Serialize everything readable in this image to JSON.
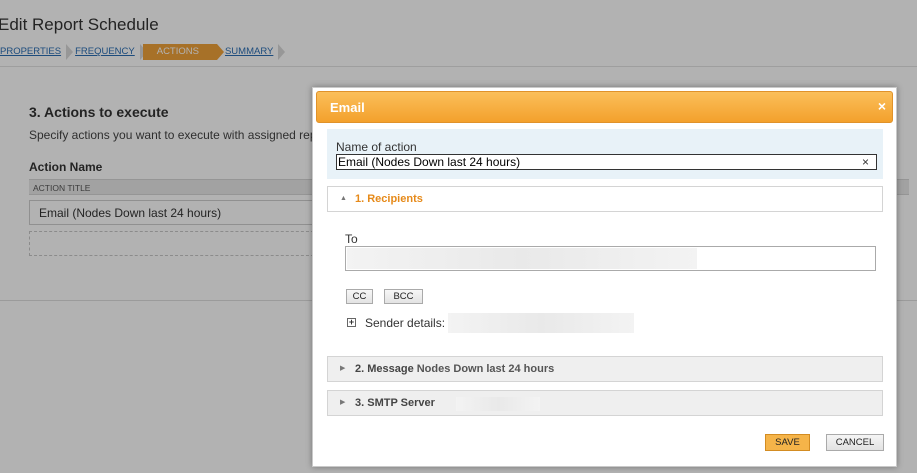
{
  "page": {
    "title": "Edit Report Schedule",
    "breadcrumbs": [
      {
        "label": "PROPERTIES",
        "active": false
      },
      {
        "label": "FREQUENCY",
        "active": false
      },
      {
        "label": "ACTIONS",
        "active": true
      },
      {
        "label": "SUMMARY",
        "active": false
      }
    ],
    "section_heading": "3. Actions to execute",
    "section_description": "Specify actions you want to execute with assigned repo",
    "action_name_label": "Action Name",
    "column_header": "ACTION TITLE",
    "action_row": "Email (Nodes Down last 24 hours)"
  },
  "dialog": {
    "title": "Email",
    "close_icon": "×",
    "name_label": "Name of action",
    "name_value": "Email (Nodes Down last 24 hours)",
    "clear_icon": "×",
    "recipients": {
      "title": "1. Recipients",
      "to_label": "To",
      "cc_label": "CC",
      "bcc_label": "BCC",
      "sender_label": "Sender details:"
    },
    "message": {
      "title": "2. Message",
      "subtitle": "Nodes Down last 24 hours"
    },
    "smtp": {
      "title": "3. SMTP Server"
    },
    "save_label": "SAVE",
    "cancel_label": "CANCEL"
  },
  "colors": {
    "accent": "#f3a12c",
    "link": "#2a6db3",
    "recipients_title": "#e68a1a"
  }
}
